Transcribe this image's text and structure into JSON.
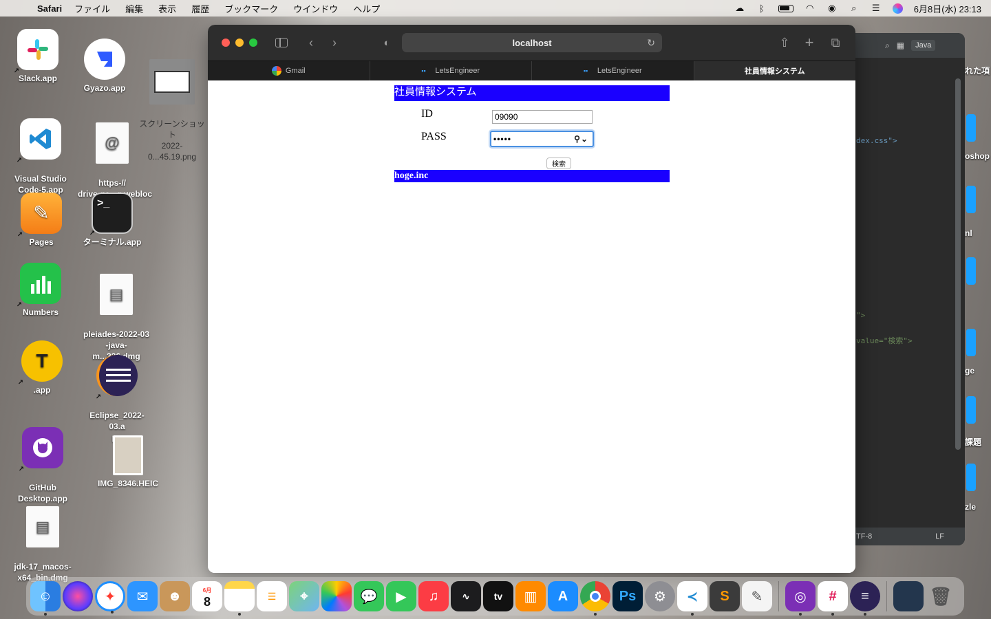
{
  "menubar": {
    "app_name": "Safari",
    "menus": [
      "ファイル",
      "編集",
      "表示",
      "履歴",
      "ブックマーク",
      "ウインドウ",
      "ヘルプ"
    ],
    "clock": "6月8日(水)  23:13"
  },
  "desktop_icons": [
    {
      "label": "Slack.app",
      "icon": "slack-icon",
      "color": "#ffffff"
    },
    {
      "label": "Gyazo.app",
      "icon": "gyazo-icon",
      "color": "#2f5bff"
    },
    {
      "label": "スクリーンショット\n2022-0...45.19.png",
      "icon": "screenshot-thumbnail-icon",
      "color": "#ffffff"
    },
    {
      "label": "Visual Studio\nCode-5.app",
      "icon": "vscode-icon",
      "color": "#1f8ad2"
    },
    {
      "label": "https-//\ndrive.go...g.webloc",
      "icon": "webloc-file-icon",
      "color": "#ffffff"
    },
    {
      "label": "Pages",
      "icon": "pages-icon",
      "color": "#f7a21b"
    },
    {
      "label": "ターミナル.app",
      "icon": "terminal-icon",
      "color": "#1e1e1e"
    },
    {
      "label": "Numbers",
      "icon": "numbers-icon",
      "color": "#24c14a"
    },
    {
      "label": "pleiades-2022-03\n-java-m...326.dmg",
      "icon": "dmg-file-icon",
      "color": "#ffffff"
    },
    {
      "label": ".app",
      "icon": "text-editor-icon",
      "color": "#f7c100"
    },
    {
      "label": "Eclipse_2022-03.a\npp",
      "icon": "eclipse-icon",
      "color": "#2c2255"
    },
    {
      "label": "GitHub\nDesktop.app",
      "icon": "github-desktop-icon",
      "color": "#7b2fb5"
    },
    {
      "label": "IMG_8346.HEIC",
      "icon": "image-file-icon",
      "color": "#d8d0c2"
    },
    {
      "label": "jdk-17_macos-\nx64_bin.dmg",
      "icon": "dmg-file-icon",
      "color": "#ffffff"
    }
  ],
  "editor": {
    "badge": "Java",
    "code_lines": [
      "dex.css\">",
      "\">",
      "value=\"検索\">"
    ],
    "encoding": "TF-8",
    "line_ending": "LF"
  },
  "right_strip_labels": [
    "れた項",
    "oshop",
    "nl",
    "ge",
    "課題",
    "zle"
  ],
  "safari": {
    "address": "localhost",
    "tabs": [
      {
        "label": "Gmail",
        "icon": "google-icon",
        "active": false
      },
      {
        "label": "LetsEngineer",
        "icon": "letsengineer-icon",
        "active": false
      },
      {
        "label": "LetsEngineer",
        "icon": "letsengineer-icon",
        "active": false
      },
      {
        "label": "社員情報システム",
        "icon": "",
        "active": true
      }
    ]
  },
  "page": {
    "header": "社員情報システム",
    "id_label": "ID",
    "id_value": "09090",
    "pass_label": "PASS",
    "pass_value": "•••••",
    "search_button": "検索",
    "footer": "hoge.inc",
    "accent_color": "#1a00ff"
  },
  "dock": [
    "Finder",
    "Siri",
    "Safari",
    "Mail",
    "Contacts",
    "Calendar",
    "Notes",
    "Reminders",
    "Maps",
    "Photos",
    "Messages",
    "FaceTime",
    "Music",
    "Stocks",
    "TV",
    "Books",
    "App Store",
    "Chrome",
    "Photoshop",
    "System Preferences",
    "VS Code",
    "Sublime Text",
    "TextEdit",
    "GitHub Desktop",
    "Slack",
    "Eclipse",
    "Screenshot",
    "Trash"
  ],
  "calendar_day": "8",
  "calendar_month": "6月"
}
